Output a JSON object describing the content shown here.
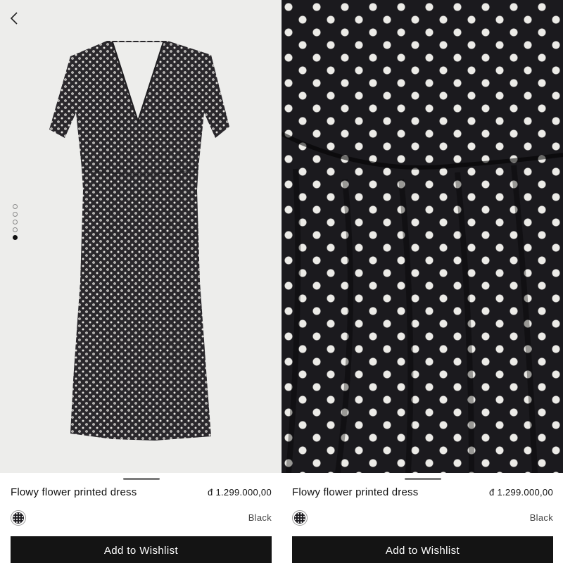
{
  "colors": {
    "button_bg": "#141414",
    "button_text": "#ffffff",
    "product_bg_light": "#ededeb",
    "fabric_dark": "#1b1a1e",
    "fabric_print": "#ecebe7"
  },
  "left_panel": {
    "back_icon": "chevron-left-icon",
    "carousel": {
      "total": 5,
      "active_index": 4
    },
    "product": {
      "title": "Flowy flower printed dress",
      "price": "đ 1.299.000,00",
      "color": "Black",
      "cta": "Add to Wishlist"
    }
  },
  "right_panel": {
    "product": {
      "title": "Flowy flower printed dress",
      "price": "đ 1.299.000,00",
      "color": "Black",
      "cta": "Add to Wishlist"
    }
  }
}
